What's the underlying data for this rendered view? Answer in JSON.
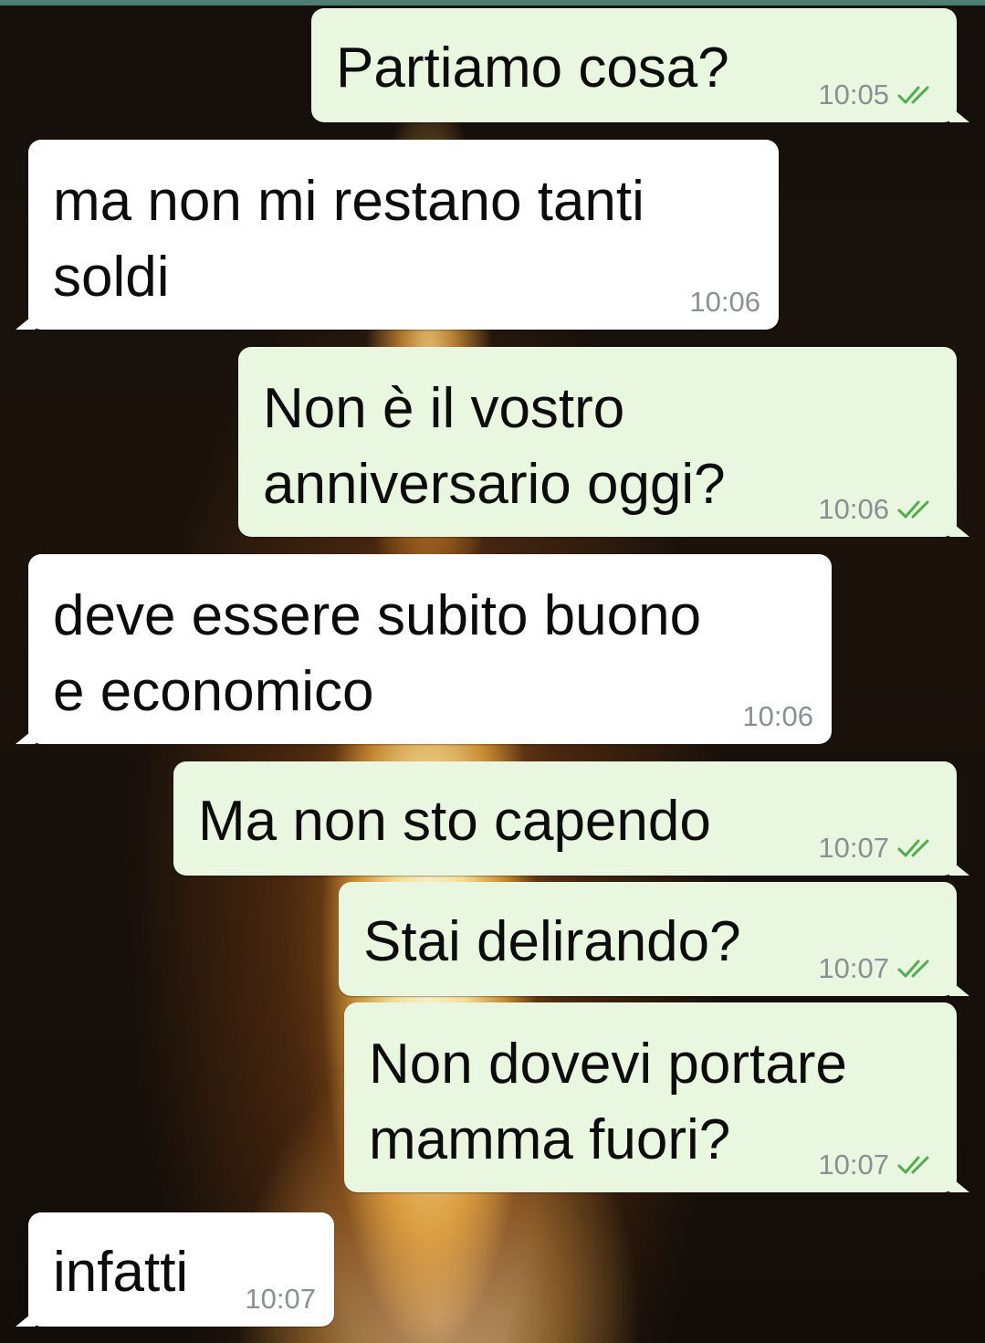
{
  "theme": {
    "outgoing_bubble": "#e9f7e1",
    "incoming_bubble": "#ffffff",
    "time_color": "#8a8f92",
    "read_tick_color": "#4fae4a",
    "top_bar_accent": "#4f7e73"
  },
  "chat": {
    "messages": [
      {
        "direction": "outgoing",
        "text": "Partiamo cosa?",
        "time": "10:05",
        "status_icon": "double-check-icon"
      },
      {
        "direction": "incoming",
        "text": "ma non mi restano tanti\nsoldi",
        "time": "10:06"
      },
      {
        "direction": "outgoing",
        "text": "Non è il vostro\nanniversario oggi?",
        "time": "10:06",
        "status_icon": "double-check-icon"
      },
      {
        "direction": "incoming",
        "text": "deve essere subito buono\ne economico",
        "time": "10:06"
      },
      {
        "direction": "outgoing",
        "text": "Ma non sto capendo",
        "time": "10:07",
        "status_icon": "double-check-icon"
      },
      {
        "direction": "outgoing",
        "text": "Stai delirando?",
        "time": "10:07",
        "status_icon": "double-check-icon"
      },
      {
        "direction": "outgoing",
        "text": "Non dovevi portare\nmamma fuori?",
        "time": "10:07",
        "status_icon": "double-check-icon"
      },
      {
        "direction": "incoming",
        "text": "infatti",
        "time": "10:07"
      }
    ]
  }
}
